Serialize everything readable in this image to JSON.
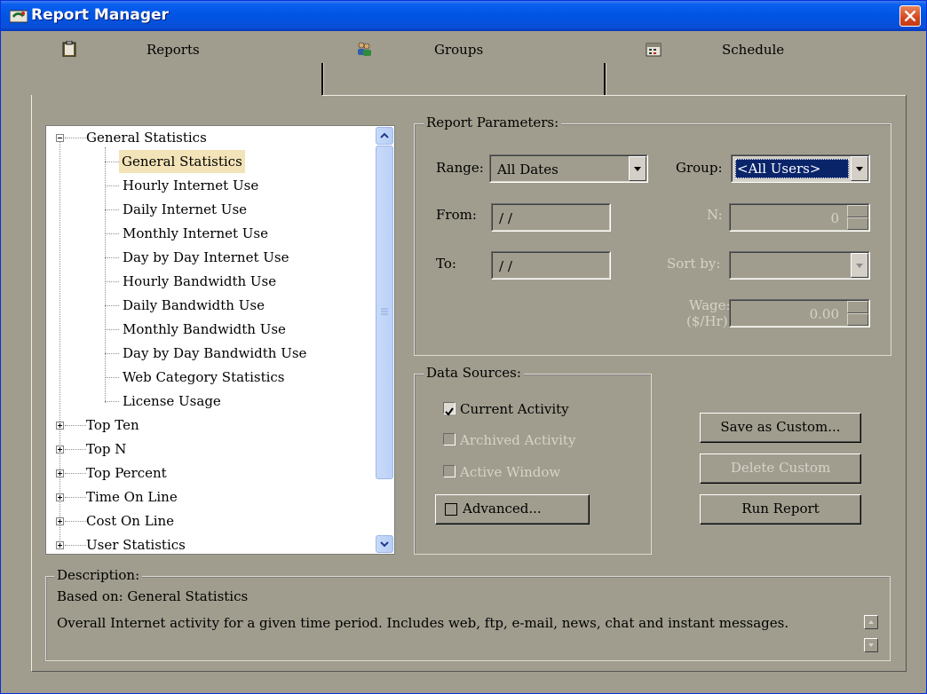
{
  "window": {
    "title": "Report Manager"
  },
  "tabs": [
    {
      "label": "Reports",
      "icon": "clipboard-icon",
      "active": true
    },
    {
      "label": "Groups",
      "icon": "users-icon",
      "active": false
    },
    {
      "label": "Schedule",
      "icon": "calendar-icon",
      "active": false
    }
  ],
  "tree": {
    "groups": [
      {
        "label": "General Statistics",
        "expanded": true,
        "children": [
          "General Statistics",
          "Hourly Internet Use",
          "Daily Internet Use",
          "Monthly Internet Use",
          "Day by Day Internet Use",
          "Hourly Bandwidth Use",
          "Daily Bandwidth Use",
          "Monthly Bandwidth Use",
          "Day by Day Bandwidth Use",
          "Web Category Statistics",
          "License Usage"
        ]
      },
      {
        "label": "Top Ten",
        "expanded": false
      },
      {
        "label": "Top N",
        "expanded": false
      },
      {
        "label": "Top Percent",
        "expanded": false
      },
      {
        "label": "Time On Line",
        "expanded": false
      },
      {
        "label": "Cost On Line",
        "expanded": false
      },
      {
        "label": "User Statistics",
        "expanded": false
      }
    ],
    "selected": "General Statistics"
  },
  "report_parameters": {
    "title": "Report Parameters:",
    "range_label": "Range:",
    "range_value": "All Dates",
    "from_label": "From:",
    "from_value": "/ /",
    "to_label": "To:",
    "to_value": "/ /",
    "group_label": "Group:",
    "group_value": "<All Users>",
    "n_label": "N:",
    "n_value": "0",
    "sort_label": "Sort by:",
    "sort_value": "",
    "wage_label": "Wage:",
    "wage_unit": "($/Hr)",
    "wage_value": "0.00"
  },
  "data_sources": {
    "title": "Data Sources:",
    "current_activity": {
      "label": "Current Activity",
      "checked": true
    },
    "archived_activity": {
      "label": "Archived Activity",
      "checked": false
    },
    "active_window": {
      "label": "Active Window",
      "checked": false
    },
    "advanced": {
      "label": "Advanced...",
      "checked": false
    }
  },
  "buttons": {
    "save_custom": "Save as Custom...",
    "delete_custom": "Delete Custom",
    "run_report": "Run Report"
  },
  "description": {
    "title": "Description:",
    "based_on": "Based on: General Statistics",
    "text": "Overall Internet activity for a given time period.  Includes web, ftp, e-mail, news, chat and instant messages."
  },
  "colors": {
    "window_bg": "#a09d8e",
    "titlebar": "#0054e3",
    "selection": "#0a246a",
    "tree_selected": "#f3e3b8"
  }
}
